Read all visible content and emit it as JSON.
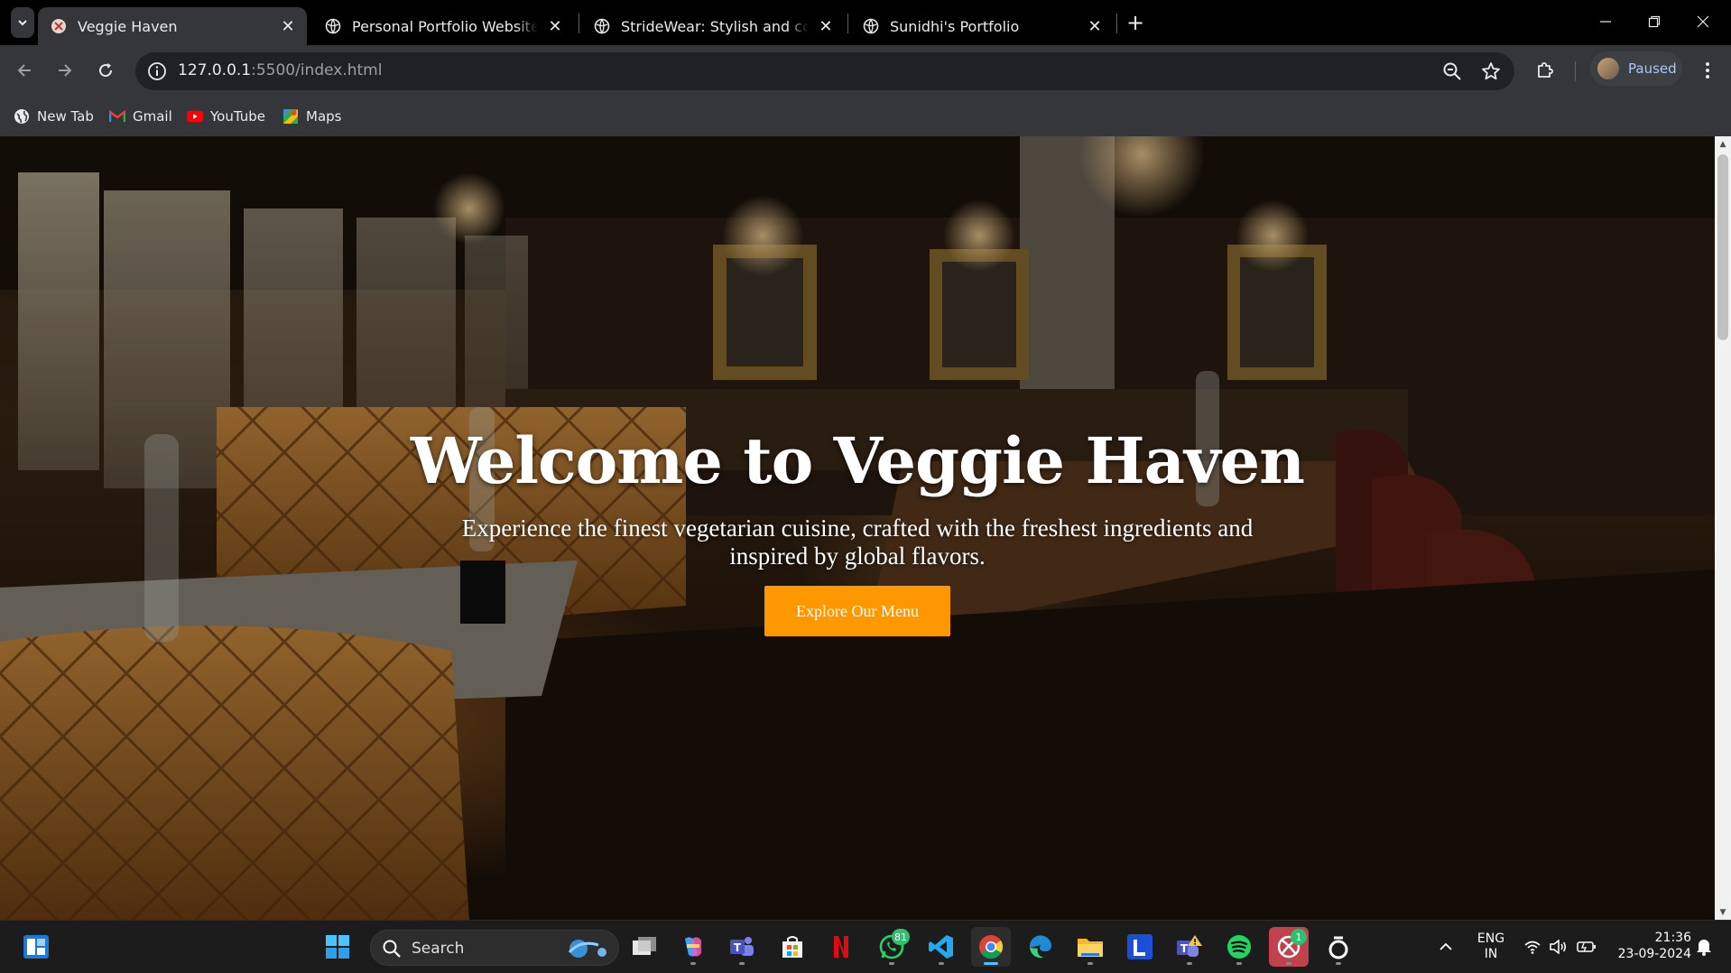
{
  "browser": {
    "tabs": [
      {
        "title": "Veggie Haven",
        "active": true
      },
      {
        "title": "Personal Portfolio Website",
        "active": false
      },
      {
        "title": "StrideWear: Stylish and comfortable",
        "active": false
      },
      {
        "title": "Sunidhi's Portfolio",
        "active": false
      }
    ],
    "url_host": "127.0.0.1",
    "url_rest": ":5500/index.html",
    "profile_status": "Paused",
    "bookmarks": [
      {
        "label": "New Tab",
        "icon": "globe-icon"
      },
      {
        "label": "Gmail",
        "icon": "gmail-icon"
      },
      {
        "label": "YouTube",
        "icon": "youtube-icon"
      },
      {
        "label": "Maps",
        "icon": "maps-icon"
      }
    ]
  },
  "hero": {
    "title": "Welcome to Veggie Haven",
    "subtitle": "Experience the finest vegetarian cuisine, crafted with the freshest ingredients and inspired by global flavors.",
    "button_label": "Explore Our Menu",
    "accent_color": "#ff9800"
  },
  "taskbar": {
    "search_placeholder": "Search",
    "apps": [
      {
        "name": "file-explorer-icon"
      },
      {
        "name": "copilot-icon"
      },
      {
        "name": "teams-icon"
      },
      {
        "name": "microsoft-store-icon"
      },
      {
        "name": "netflix-icon"
      },
      {
        "name": "whatsapp-icon",
        "badge": "81"
      },
      {
        "name": "vscode-icon"
      },
      {
        "name": "chrome-icon",
        "active": true
      },
      {
        "name": "edge-icon"
      },
      {
        "name": "folder-icon"
      },
      {
        "name": "l-app-icon"
      },
      {
        "name": "teams-alert-icon"
      },
      {
        "name": "spotify-icon"
      },
      {
        "name": "xbox-icon",
        "badge": "1"
      },
      {
        "name": "ring-app-icon"
      }
    ],
    "language_top": "ENG",
    "language_bottom": "IN",
    "time": "21:36",
    "date": "23-09-2024"
  }
}
